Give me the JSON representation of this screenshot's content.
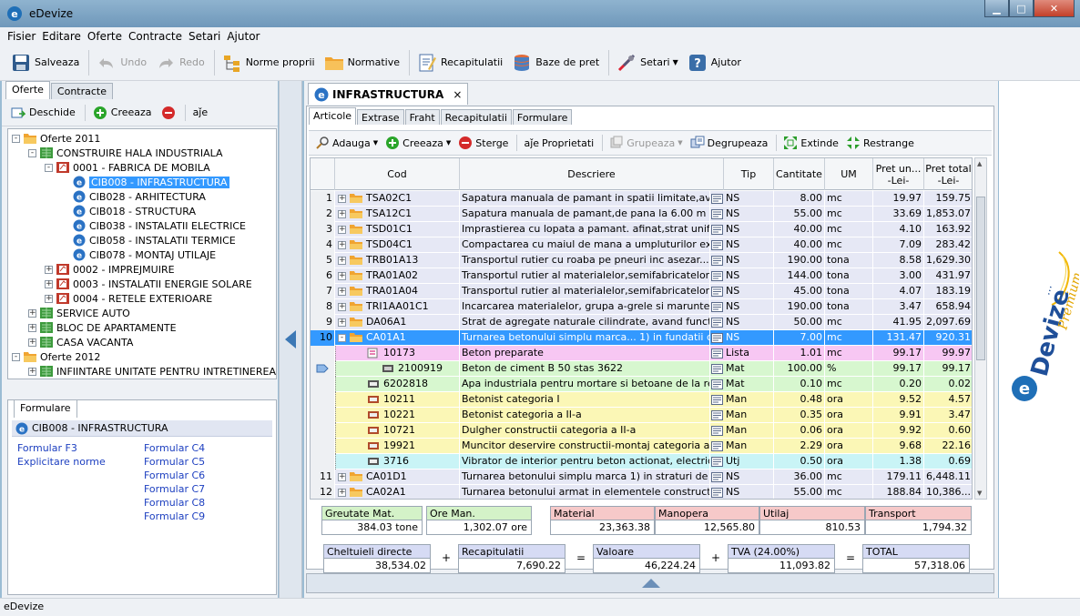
{
  "app": {
    "title": "eDevize",
    "status": "eDevize"
  },
  "menu": [
    "Fisier",
    "Editare",
    "Oferte",
    "Contracte",
    "Setari",
    "Ajutor"
  ],
  "toolbar": {
    "save": "Salveaza",
    "undo": "Undo",
    "redo": "Redo",
    "norme": "Norme proprii",
    "normative": "Normative",
    "recap": "Recapitulatii",
    "baze": "Baze de pret",
    "setari": "Setari",
    "ajutor": "Ajutor"
  },
  "left": {
    "tabs": [
      "Oferte",
      "Contracte"
    ],
    "open": "Deschide",
    "create": "Creeaza",
    "aje": "aǰe",
    "tree": [
      {
        "label": "Oferte 2011",
        "level": 0,
        "type": "folder",
        "exp": "-"
      },
      {
        "label": "CONSTRUIRE HALA INDUSTRIALA",
        "level": 1,
        "type": "group",
        "exp": "-"
      },
      {
        "label": "0001 - FABRICA DE MOBILA",
        "level": 2,
        "type": "obj",
        "exp": "-"
      },
      {
        "label": "CIB008 - INFRASTRUCTURA",
        "level": 3,
        "type": "e",
        "exp": "",
        "selected": true
      },
      {
        "label": "CIB028 - ARHITECTURA",
        "level": 3,
        "type": "e",
        "exp": ""
      },
      {
        "label": "CIB018 - STRUCTURA",
        "level": 3,
        "type": "e",
        "exp": ""
      },
      {
        "label": "CIB038 - INSTALATII ELECTRICE",
        "level": 3,
        "type": "e",
        "exp": ""
      },
      {
        "label": "CIB058 - INSTALATII TERMICE",
        "level": 3,
        "type": "e",
        "exp": ""
      },
      {
        "label": "CIB078 - MONTAJ UTILAJE",
        "level": 3,
        "type": "e",
        "exp": ""
      },
      {
        "label": "0002 - IMPREJMUIRE",
        "level": 2,
        "type": "obj",
        "exp": "+"
      },
      {
        "label": "0003 - INSTALATII ENERGIE SOLARE",
        "level": 2,
        "type": "obj",
        "exp": "+"
      },
      {
        "label": "0004 - RETELE EXTERIOARE",
        "level": 2,
        "type": "obj",
        "exp": "+"
      },
      {
        "label": "SERVICE AUTO",
        "level": 1,
        "type": "group",
        "exp": "+"
      },
      {
        "label": "BLOC DE APARTAMENTE",
        "level": 1,
        "type": "group",
        "exp": "+"
      },
      {
        "label": "CASA VACANTA",
        "level": 1,
        "type": "group",
        "exp": "+"
      },
      {
        "label": "Oferte 2012",
        "level": 0,
        "type": "folder",
        "exp": "-"
      },
      {
        "label": "INFIINTARE UNITATE PENTRU INTRETINEREA SI",
        "level": 1,
        "type": "group",
        "exp": "+"
      }
    ],
    "formular": {
      "tab": "Formulare",
      "header": "CIB008 - INFRASTRUCTURA",
      "col1": [
        "Formular F3",
        "Explicitare norme"
      ],
      "col2": [
        "Formular C4",
        "Formular C5",
        "Formular C6",
        "Formular C7",
        "Formular C8",
        "Formular C9"
      ]
    }
  },
  "doc": {
    "tab": "INFRASTRUCTURA",
    "close": "×",
    "subtabs": [
      "Articole",
      "Extrase",
      "Fraht",
      "Recapitulatii",
      "Formulare"
    ],
    "tools": {
      "adauga": "Adauga",
      "creeaza": "Creeaza",
      "sterge": "Sterge",
      "prop": "Proprietati",
      "grup": "Grupeaza",
      "degrup": "Degrupeaza",
      "ext": "Extinde",
      "restr": "Restrange",
      "aje": "aǰe"
    },
    "columns": {
      "cod": "Cod",
      "desc": "Descriere",
      "tip": "Tip",
      "cant": "Cantitate",
      "um": "UM",
      "pu1": "Pret un...",
      "pu2": "-Lei-",
      "pt1": "Pret total",
      "pt2": "-Lei-"
    },
    "rows": [
      {
        "n": "1",
        "code": "TSA02C1",
        "desc": "Sapatura manuala de pamant in spatii limitate,avand s...",
        "tip": "NS",
        "cant": "8.00",
        "um": "mc",
        "pu": "19.97",
        "pt": "159.75",
        "kind": "main"
      },
      {
        "n": "2",
        "code": "TSA12C1",
        "desc": "Sapatura manuala de pamant,de pana la 6.00 m adan...",
        "tip": "NS",
        "cant": "55.00",
        "um": "mc",
        "pu": "33.69",
        "pt": "1,853.07",
        "kind": "main"
      },
      {
        "n": "3",
        "code": "TSD01C1",
        "desc": "Imprastierea cu lopata a pamant. afinat,strat uniform...",
        "tip": "NS",
        "cant": "40.00",
        "um": "mc",
        "pu": "4.10",
        "pt": "163.92",
        "kind": "main"
      },
      {
        "n": "4",
        "code": "TSD04C1",
        "desc": "Compactarea cu maiul de mana a umpluturilor executa...",
        "tip": "NS",
        "cant": "40.00",
        "um": "mc",
        "pu": "7.09",
        "pt": "283.42",
        "kind": "main"
      },
      {
        "n": "5",
        "code": "TRB01A13",
        "desc": "Transportul rutier cu roaba pe pneuri inc asezar...",
        "tip": "NS",
        "cant": "190.00",
        "um": "tona",
        "pu": "8.58",
        "pt": "1,629.30",
        "kind": "main"
      },
      {
        "n": "6",
        "code": "TRA01A02",
        "desc": "Transportul rutier al materialelor,semifabricatelor cu a...",
        "tip": "NS",
        "cant": "144.00",
        "um": "tona",
        "pu": "3.00",
        "pt": "431.97",
        "kind": "main"
      },
      {
        "n": "7",
        "code": "TRA01A04",
        "desc": "Transportul rutier al materialelor,semifabricatelor cu a...",
        "tip": "NS",
        "cant": "45.00",
        "um": "tona",
        "pu": "4.07",
        "pt": "183.19",
        "kind": "main"
      },
      {
        "n": "8",
        "code": "TRI1AA01C1",
        "desc": "Incarcarea materialelor, grupa a-grele si marunte,prin...",
        "tip": "NS",
        "cant": "190.00",
        "um": "tona",
        "pu": "3.47",
        "pt": "658.94",
        "kind": "main"
      },
      {
        "n": "9",
        "code": "DA06A1",
        "desc": "Strat de agregate naturale cilindrate, avand functia d...",
        "tip": "NS",
        "cant": "50.00",
        "um": "mc",
        "pu": "41.95",
        "pt": "2,097.69",
        "kind": "main"
      },
      {
        "n": "10",
        "code": "CA01A1",
        "desc": "Turnarea betonului simplu marca... 1) in fundatii contin...",
        "tip": "NS",
        "cant": "7.00",
        "um": "mc",
        "pu": "131.47",
        "pt": "920.31",
        "kind": "sel"
      },
      {
        "n": "",
        "code": "10173",
        "desc": "Beton preparate",
        "tip": "Lista",
        "cant": "1.01",
        "um": "mc",
        "pu": "99.17",
        "pt": "99.97",
        "kind": "lista"
      },
      {
        "n": "",
        "code": "2100919",
        "desc": "Beton de ciment   B  50   stas  3622",
        "tip": "Mat",
        "cant": "100.00",
        "um": "%",
        "pu": "99.17",
        "pt": "99.17",
        "kind": "mat2"
      },
      {
        "n": "",
        "code": "6202818",
        "desc": "Apa industriala pentru mortare si betoane de la retea",
        "tip": "Mat",
        "cant": "0.10",
        "um": "mc",
        "pu": "0.20",
        "pt": "0.02",
        "kind": "mat"
      },
      {
        "n": "",
        "code": "10211",
        "desc": "Betonist categoria I",
        "tip": "Man",
        "cant": "0.48",
        "um": "ora",
        "pu": "9.52",
        "pt": "4.57",
        "kind": "man"
      },
      {
        "n": "",
        "code": "10221",
        "desc": "Betonist categoria a II-a",
        "tip": "Man",
        "cant": "0.35",
        "um": "ora",
        "pu": "9.91",
        "pt": "3.47",
        "kind": "man"
      },
      {
        "n": "",
        "code": "10721",
        "desc": "Dulgher constructii categoria a II-a",
        "tip": "Man",
        "cant": "0.06",
        "um": "ora",
        "pu": "9.92",
        "pt": "0.60",
        "kind": "man"
      },
      {
        "n": "",
        "code": "19921",
        "desc": "Muncitor deservire constructii-montaj categoria a II-a",
        "tip": "Man",
        "cant": "2.29",
        "um": "ora",
        "pu": "9.68",
        "pt": "22.16",
        "kind": "man"
      },
      {
        "n": "",
        "code": "3716",
        "desc": "Vibrator de interior pentru beton actionat, electric 0,9...",
        "tip": "Utj",
        "cant": "0.50",
        "um": "ora",
        "pu": "1.38",
        "pt": "0.69",
        "kind": "utj"
      },
      {
        "n": "11",
        "code": "CA01D1",
        "desc": "Turnarea betonului simplu marca  1) in straturi de 3-2...",
        "tip": "NS",
        "cant": "36.00",
        "um": "mc",
        "pu": "179.11",
        "pt": "6,448.11",
        "kind": "main"
      },
      {
        "n": "12",
        "code": "CA02A1",
        "desc": "Turnarea betonului armat in elementele constructiilor, ...",
        "tip": "NS",
        "cant": "55.00",
        "um": "mc",
        "pu": "188.84",
        "pt": "10,386...",
        "kind": "main"
      }
    ],
    "totals": {
      "greutate": {
        "label": "Greutate Mat.",
        "value": "384.03 tone"
      },
      "ore": {
        "label": "Ore Man.",
        "value": "1,302.07 ore"
      },
      "material": {
        "label": "Material",
        "value": "23,363.38"
      },
      "manopera": {
        "label": "Manopera",
        "value": "12,565.80"
      },
      "utilaj": {
        "label": "Utilaj",
        "value": "810.53"
      },
      "transport": {
        "label": "Transport",
        "value": "1,794.32"
      },
      "ch": {
        "label": "Cheltuieli directe",
        "value": "38,534.02"
      },
      "recap": {
        "label": "Recapitulatii",
        "value": "7,690.22"
      },
      "val": {
        "label": "Valoare",
        "value": "46,224.24"
      },
      "tva": {
        "label": "TVA (24.00%)",
        "value": "11,093.82"
      },
      "total": {
        "label": "TOTAL",
        "value": "57,318.06"
      },
      "ops": [
        "+",
        "=",
        "+",
        "="
      ]
    }
  },
  "ad": {
    "brand": "Devize",
    "sub": "Premium",
    "dots": "..."
  }
}
